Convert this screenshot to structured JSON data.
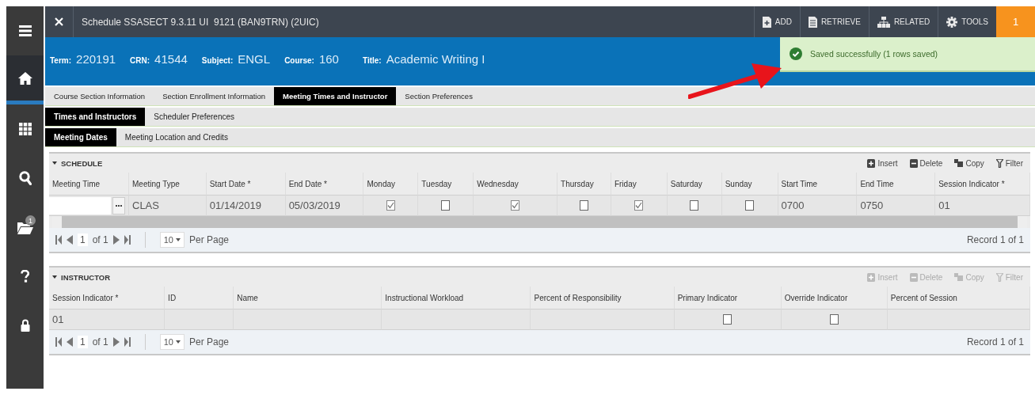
{
  "sidebar": {
    "items": [
      {
        "kind": "menu",
        "selected": false
      },
      {
        "kind": "home",
        "selected": true
      },
      {
        "kind": "apps",
        "selected": false
      },
      {
        "kind": "search",
        "selected": false
      },
      {
        "kind": "folder",
        "selected": false,
        "badge": "1"
      },
      {
        "kind": "help",
        "selected": false
      },
      {
        "kind": "lock",
        "selected": false
      }
    ]
  },
  "header": {
    "title": "Schedule SSASECT 9.3.11 UI  9121 (BAN9TRN) (2UIC)",
    "buttons": [
      {
        "kind": "add",
        "label": "ADD"
      },
      {
        "kind": "retrieve",
        "label": "RETRIEVE"
      },
      {
        "kind": "related",
        "label": "RELATED"
      },
      {
        "kind": "tools",
        "label": "TOOLS"
      }
    ],
    "notification_count": "1"
  },
  "key_block": [
    {
      "label": "Term:",
      "value": "220191"
    },
    {
      "label": "CRN:",
      "value": "41544"
    },
    {
      "label": "Subject:",
      "value": "ENGL"
    },
    {
      "label": "Course:",
      "value": "160"
    },
    {
      "label": "Title:",
      "value": "Academic Writing I"
    }
  ],
  "notification": {
    "text": "Saved successfully (1 rows saved)"
  },
  "tabs": [
    {
      "label": "Course Section Information",
      "selected": false
    },
    {
      "label": "Section Enrollment Information",
      "selected": false
    },
    {
      "label": "Meeting Times and Instructor",
      "selected": true
    },
    {
      "label": "Section Preferences",
      "selected": false
    }
  ],
  "subtabs": [
    {
      "label": "Times and Instructors",
      "selected": true
    },
    {
      "label": "Scheduler Preferences",
      "selected": false
    }
  ],
  "detail_tabs": [
    {
      "label": "Meeting Dates",
      "selected": true
    },
    {
      "label": "Meeting Location and Credits",
      "selected": false
    }
  ],
  "sections": [
    {
      "title": "SCHEDULE",
      "actions": [
        {
          "kind": "insert",
          "label": "Insert",
          "disabled": false
        },
        {
          "kind": "delete",
          "label": "Delete",
          "disabled": false
        },
        {
          "kind": "copy",
          "label": "Copy",
          "disabled": false
        },
        {
          "kind": "filter",
          "label": "Filter",
          "disabled": false
        }
      ],
      "columns": [
        "Meeting Time",
        "Meeting Type",
        "Start Date *",
        "End Date *",
        "Monday",
        "Tuesday",
        "Wednesday",
        "Thursday",
        "Friday",
        "Saturday",
        "Sunday",
        "Start Time",
        "End Time",
        "Session Indicator *"
      ],
      "rows": [
        {
          "cells": [
            {
              "kind": "lookup"
            },
            {
              "kind": "text",
              "text": "CLAS"
            },
            {
              "kind": "text",
              "text": "01/14/2019"
            },
            {
              "kind": "text",
              "text": "05/03/2019"
            },
            {
              "kind": "check",
              "checked": true
            },
            {
              "kind": "check",
              "checked": false
            },
            {
              "kind": "check",
              "checked": true
            },
            {
              "kind": "check",
              "checked": false
            },
            {
              "kind": "check",
              "checked": true
            },
            {
              "kind": "check",
              "checked": false
            },
            {
              "kind": "check",
              "checked": false
            },
            {
              "kind": "text",
              "text": "0700"
            },
            {
              "kind": "text",
              "text": "0750"
            },
            {
              "kind": "text",
              "text": "01"
            }
          ]
        }
      ],
      "pager": {
        "page": "1",
        "of": "of 1",
        "per_page": "10",
        "per_page_label": "Per Page",
        "record": "Record 1 of 1"
      }
    },
    {
      "title": "INSTRUCTOR",
      "actions": [
        {
          "kind": "insert",
          "label": "Insert",
          "disabled": true
        },
        {
          "kind": "delete",
          "label": "Delete",
          "disabled": true
        },
        {
          "kind": "copy",
          "label": "Copy",
          "disabled": true
        },
        {
          "kind": "filter",
          "label": "Filter",
          "disabled": true
        }
      ],
      "columns": [
        "Session Indicator *",
        "ID",
        "Name",
        "Instructional Workload",
        "Percent of Responsibility",
        "Primary Indicator",
        "Override Indicator",
        "Percent of Session"
      ],
      "rows": [
        {
          "cells": [
            {
              "kind": "text",
              "text": "01"
            },
            {
              "kind": "blank"
            },
            {
              "kind": "blank"
            },
            {
              "kind": "blank"
            },
            {
              "kind": "blank"
            },
            {
              "kind": "check",
              "checked": false
            },
            {
              "kind": "check",
              "checked": false
            },
            {
              "kind": "blank"
            }
          ]
        }
      ],
      "pager": {
        "page": "1",
        "of": "of 1",
        "per_page": "10",
        "per_page_label": "Per Page",
        "record": "Record 1 of 1"
      }
    }
  ]
}
